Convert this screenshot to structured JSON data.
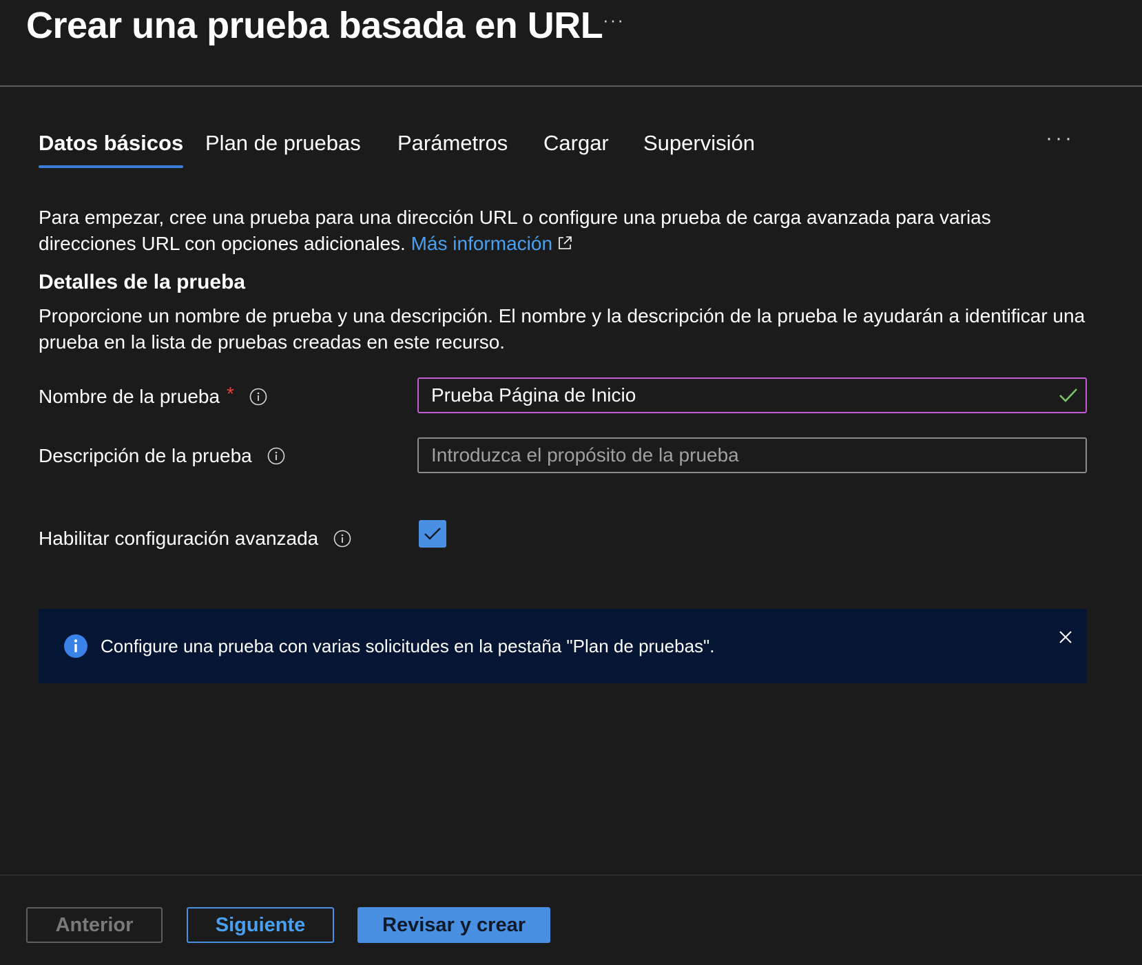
{
  "header": {
    "title": "Crear una prueba basada en URL",
    "more_label": "···"
  },
  "tabs": {
    "items": [
      {
        "label": "Datos básicos",
        "active": true
      },
      {
        "label": "Plan de pruebas",
        "active": false
      },
      {
        "label": "Parámetros",
        "active": false
      },
      {
        "label": "Cargar",
        "active": false
      },
      {
        "label": "Supervisión",
        "active": false
      }
    ],
    "more_label": "···"
  },
  "intro": {
    "text": "Para empezar, cree una prueba para una dirección URL o configure una prueba de carga avanzada para varias direcciones URL con opciones adicionales.",
    "link_label": "Más información",
    "link_icon": "external-link-icon"
  },
  "details": {
    "title": "Detalles de la prueba",
    "description": "Proporcione un nombre de prueba y una descripción. El nombre y la descripción de la prueba le ayudarán a identificar una prueba en la lista de pruebas creadas en este recurso."
  },
  "form": {
    "name_label": "Nombre de la prueba",
    "name_required": "*",
    "name_value": "Prueba Página de Inicio",
    "description_label": "Descripción de la prueba",
    "description_placeholder": "Introduzca el propósito de la prueba",
    "description_value": "",
    "advanced_label": "Habilitar configuración avanzada",
    "advanced_checked": true
  },
  "banner": {
    "text": "Configure una prueba con varias solicitudes en la pestaña \"Plan de pruebas\".",
    "icon": "info-filled-icon",
    "close_icon": "close-icon"
  },
  "footer": {
    "prev_label": "Anterior",
    "next_label": "Siguiente",
    "review_label": "Revisar y crear"
  },
  "colors": {
    "background": "#1b1b1b",
    "accent": "#4a90e2",
    "link": "#4aa0f0",
    "required": "#e0413a",
    "focus_border": "#c25bd6",
    "valid_check": "#7cc46a",
    "banner_bg": "#051634"
  }
}
